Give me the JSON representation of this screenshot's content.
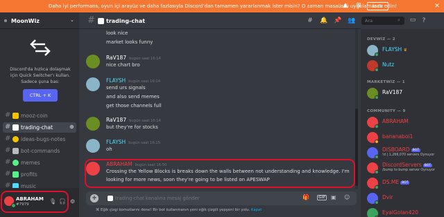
{
  "banner": {
    "text": "Daha iyi performans, oyun içi arayüz ve daha fazlasıyla Discord'dan tamamen yararlanmak ister misin? O zaman masaüstü uygulamasını edin!",
    "button": "İndir",
    "close": "✕"
  },
  "server": {
    "name": "MoonWiz"
  },
  "switcher": {
    "text": "Discord'da hızlıca dolaşmak için Quick Switcher'ı kullan. Sadece şuna bas:",
    "button": "CTRL + K"
  },
  "channels": [
    {
      "name": "mooz-coin",
      "emoji_color": "#f5c400",
      "active": false
    },
    {
      "name": "trading-chat",
      "emoji_color": "#ffffff",
      "active": true
    },
    {
      "name": "ideas-bugs-notes",
      "emoji_color": "#f5c400",
      "active": false
    },
    {
      "name": "bot-commands",
      "emoji_color": "#b9bbbe",
      "active": false
    },
    {
      "name": "memes",
      "emoji_color": "#57f287",
      "active": false
    },
    {
      "name": "profits",
      "emoji_color": "#57f287",
      "active": false
    },
    {
      "name": "music",
      "emoji_color": "#4fdcff",
      "active": false
    }
  ],
  "user": {
    "name": "ABRAHAM",
    "tag": "#7979"
  },
  "header": {
    "channel": "trading-chat",
    "search_placeholder": "Ara"
  },
  "messages": {
    "lines_top": [
      "look nice",
      "market looks funny"
    ],
    "rav_1": {
      "author": "RaV187",
      "time": "bugün saat 16:14",
      "lines": [
        "nice chart bro"
      ]
    },
    "flaysh_1": {
      "author": "FLAYSH",
      "time": "bugün saat 16:14",
      "lines": [
        "send urs signals",
        "and also send memes",
        "get those channels full"
      ]
    },
    "rav_2": {
      "author": "RaV187",
      "time": "bugün saat 16:14",
      "lines": [
        "but they're for stocks"
      ]
    },
    "flaysh_2": {
      "author": "FLAYSH",
      "time": "bugün saat 16:15",
      "lines": [
        "oh"
      ]
    },
    "abraham": {
      "author": "ABRAHAM",
      "time": "bugün saat 16:50",
      "lines": [
        "Crossing the Yellow Blocks is breaks down the walls between not understanding and knowledge. I'm",
        "looking for more news, soon they're going to be listed on APESWAP"
      ]
    }
  },
  "input": {
    "placeholder": "trading-chat kanalına mesaj gönder",
    "gif": "GIF"
  },
  "tip": {
    "text": "Eğik çizgi komutlarını dene! Bir bot kullanmanın yeni eğik çizgili yepyeni bir yolu.",
    "close": "Kapat"
  },
  "members": {
    "devwiz_header": "DEVWİZ — 2",
    "marketwiz_header": "MARKETWİZ — 1",
    "community_header": "COMMUNITY — 9",
    "list": [
      {
        "name": "FLAYSH",
        "color": "#4fdcff",
        "status": ""
      },
      {
        "name": "Nutz",
        "color": "#4fdcff",
        "status": ""
      },
      {
        "name": "RaV187",
        "color": "#ffffff",
        "status": ""
      },
      {
        "name": "ABRAHAM",
        "color": "#ed4245",
        "status": ""
      },
      {
        "name": "bananaboi1",
        "color": "#ed4245",
        "status": ""
      },
      {
        "name": "DISBOARD",
        "color": "#ed4245",
        "status": "!d | 1,266,070 servers Oynuyor",
        "bot": "BOT"
      },
      {
        "name": "DiscordServers",
        "color": "#ed4245",
        "status": "/bump to bump server Oynuyor",
        "bot": "BOT"
      },
      {
        "name": "DS.ME",
        "color": "#ed4245",
        "status": "",
        "bot": "BOT"
      },
      {
        "name": "Dvir",
        "color": "#ed4245",
        "status": ""
      },
      {
        "name": "EyalGolan420",
        "color": "#ed4245",
        "status": ""
      }
    ]
  },
  "colors": {
    "accent": "#5865f2",
    "banner": "#f57731",
    "highlight": "#e0102a",
    "online": "#3ba55d"
  }
}
